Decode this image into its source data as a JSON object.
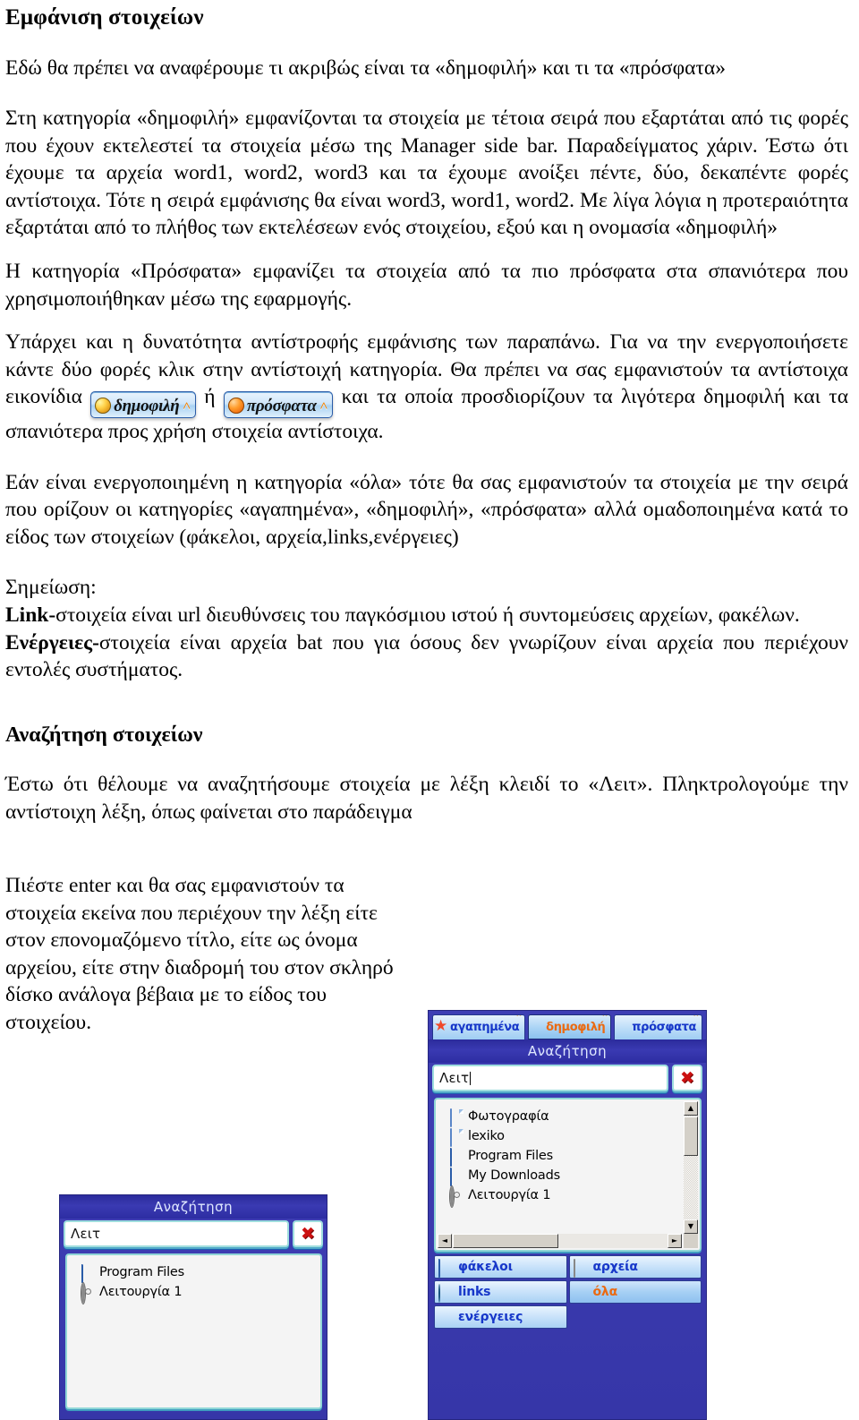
{
  "doc": {
    "heading1": "Εμφάνιση στοιχείων",
    "p1": "Εδώ θα πρέπει να αναφέρουμε τι ακριβώς είναι τα «δημοφιλή» και τι τα «πρόσφατα»",
    "p2": "Στη κατηγορία «δημοφιλή» εμφανίζονται τα στοιχεία με τέτοια σειρά που εξαρτάται από τις φορές που έχουν εκτελεστεί τα στοιχεία μέσω της Manager side bar. Παραδείγματος χάριν. Έστω ότι έχουμε τα αρχεία word1, word2, word3 και τα έχουμε ανοίξει πέντε, δύο, δεκαπέντε φορές αντίστοιχα. Τότε η σειρά εμφάνισης θα είναι word3, word1, word2. Με λίγα λόγια η προτεραιότητα εξαρτάται από το πλήθος των εκτελέσεων ενός στοιχείου, εξού και η ονομασία «δημοφιλή»",
    "p3": "Η κατηγορία «Πρόσφατα» εμφανίζει τα στοιχεία από τα πιο πρόσφατα στα σπανιότερα που χρησιμοποιήθηκαν μέσω της εφαρμογής.",
    "p4a": "Υπάρχει και η δυνατότητα αντίστροφής εμφάνισης των παραπάνω. Για να την ενεργοποιήσετε κάντε δύο φορές κλικ στην αντίστοιχή κατηγορία. Θα πρέπει να σας εμφανιστούν τα αντίστοιχα εικονίδια",
    "p4_or": "ή",
    "p4b": "και τα οποία προσδιορίζουν τα λιγότερα δημοφιλή και τα σπανιότερα προς χρήση στοιχεία αντίστοιχα.",
    "p5": "Εάν είναι ενεργοποιημένη η κατηγορία «όλα» τότε θα σας εμφανιστούν τα στοιχεία με την σειρά που ορίζουν οι κατηγορίες «αγαπημένα», «δημοφιλή», «πρόσφατα» αλλά ομαδοποιημένα κατά το είδος των στοιχείων (φάκελοι, αρχεία,links,ενέργειες)",
    "note_label": "Σημείωση:",
    "note_link_bold": "Link-",
    "note_link_rest": "στοιχεία είναι url διευθύνσεις του παγκόσμιου ιστού ή συντομεύσεις αρχείων, φακέλων.",
    "note_act_bold": "Ενέργειες-",
    "note_act_rest": "στοιχεία είναι αρχεία bat που για όσους δεν γνωρίζουν είναι αρχεία που περιέχουν εντολές συστήματος.",
    "heading2": "Αναζήτηση στοιχείων",
    "p6": "Έστω ότι θέλουμε να αναζητήσουμε στοιχεία με λέξη κλειδί το «Λειτ». Πληκτρολογούμε την αντίστοιχη λέξη, όπως φαίνεται στο παράδειγμα",
    "p7": "Πιέστε enter και θα σας εμφανιστούν τα στοιχεία εκείνα που περιέχουν την λέξη είτε στον επονομαζόμενο τίτλο, είτε ως όνομα αρχείου, είτε στην διαδρομή του στον σκληρό δίσκο ανάλογα βέβαια με το είδος του στοιχείου."
  },
  "inline_buttons": [
    {
      "label": "δημοφιλή",
      "icon": "popular-ball-icon",
      "caret": "˄"
    },
    {
      "label": "πρόσφατα",
      "icon": "recent-ball-icon",
      "caret": "˄"
    }
  ],
  "app_right": {
    "tabs": [
      {
        "label": "αγαπημένα",
        "icon": "star-icon",
        "selected": false,
        "color": "#1737c9"
      },
      {
        "label": "δημοφιλή",
        "icon": "popular-ball-icon",
        "selected": true,
        "color": "#ea6a12"
      },
      {
        "label": "πρόσφατα",
        "icon": "recent-ball-icon",
        "selected": false,
        "color": "#1737c9"
      }
    ],
    "title": "Αναζήτηση",
    "search_value": "Λειτ",
    "clear_icon": "close-x-icon",
    "list": [
      {
        "label": "Φωτογραφία",
        "icon": "file-icon"
      },
      {
        "label": "lexiko",
        "icon": "file-icon"
      },
      {
        "label": "Program Files",
        "icon": "folder-icon"
      },
      {
        "label": "My Downloads",
        "icon": "folder-icon"
      },
      {
        "label": "Λειτουργία 1",
        "icon": "gear-icon"
      }
    ],
    "scroll": {
      "up": "▲",
      "down": "▼",
      "left": "◄",
      "right": "►"
    },
    "buttons": [
      {
        "label": "φάκελοι",
        "icon": "folder-icon",
        "selected": false,
        "color": "#1737c9"
      },
      {
        "label": "αρχεία",
        "icon": "document-icon",
        "selected": false,
        "color": "#1737c9"
      },
      {
        "label": "links",
        "icon": "globe-icon",
        "selected": false,
        "color": "#1737c9"
      },
      {
        "label": "όλα",
        "icon": "grid-icon",
        "selected": true,
        "color": "#ea6a12"
      },
      {
        "label": "ενέργειες",
        "icon": "gears-icon",
        "selected": false,
        "color": "#1737c9"
      }
    ]
  },
  "app_left": {
    "title": "Αναζήτηση",
    "search_value": "Λειτ",
    "clear_icon": "close-x-icon",
    "list": [
      {
        "label": "Program Files",
        "icon": "folder-icon"
      },
      {
        "label": "Λειτουργία 1",
        "icon": "gear-icon"
      }
    ]
  },
  "colors": {
    "app_bg": "#3b3bb0",
    "tab_text": "#1737c9",
    "accent_orange": "#ea6a12",
    "clear_red": "#cc1111"
  }
}
